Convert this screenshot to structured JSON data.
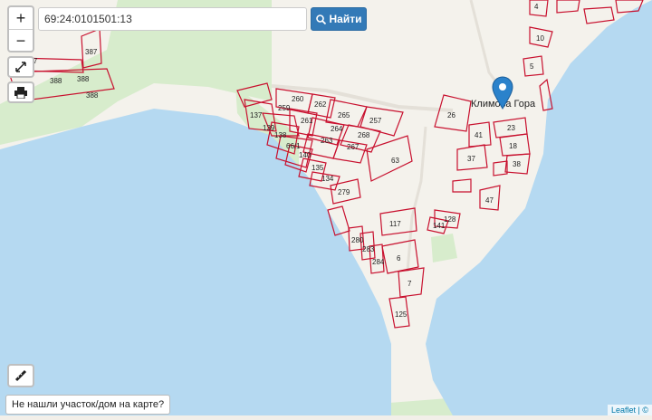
{
  "search": {
    "value": "69:24:0101501:13",
    "button_label": "Найти"
  },
  "controls": {
    "zoom_in": "+",
    "zoom_out": "−"
  },
  "village_label": "Климова Гора",
  "not_found_text": "Не нашли участок/дом на карте?",
  "attribution": "Leaflet | ©",
  "parcels": [
    "387",
    "388",
    "388",
    "388",
    "387",
    "260",
    "262",
    "259",
    "261",
    "265",
    "257",
    "137",
    "139",
    "138",
    "264",
    "268",
    "263",
    "267",
    "66/1",
    "140",
    "135",
    "134",
    "63",
    "279",
    "26",
    "41",
    "37",
    "23",
    "18",
    "38",
    "47",
    "10",
    "5",
    "4",
    "128",
    "141",
    "117",
    "280",
    "283",
    "284",
    "6",
    "7",
    "125"
  ],
  "colors": {
    "water": "#b4d8f0",
    "land": "#f2efe9",
    "forest": "#d6eccb",
    "parcel_stroke": "#c8102e",
    "marker": "#2b82cb",
    "button": "#337ab7"
  }
}
